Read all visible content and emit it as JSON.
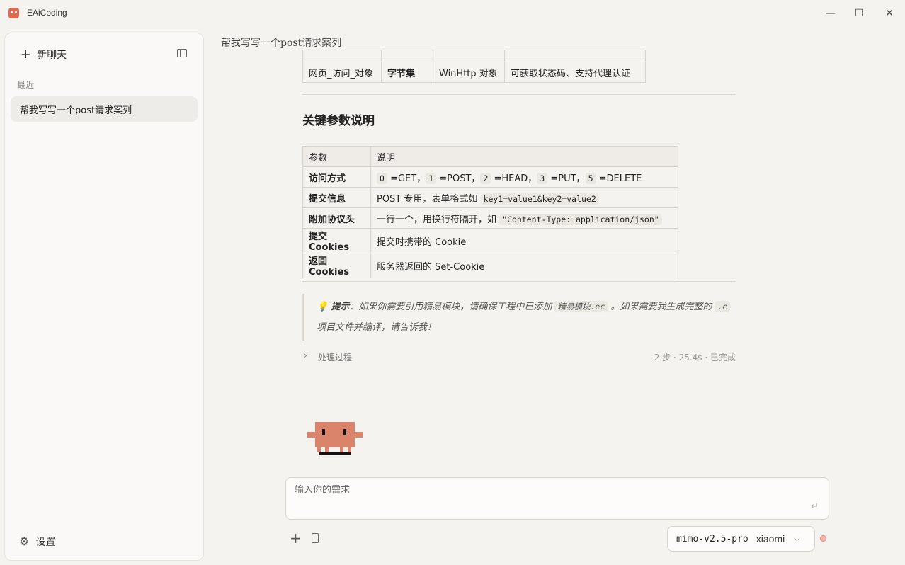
{
  "app": {
    "title": "EAiCoding"
  },
  "window_controls": {
    "minimize": "—",
    "maximize": "☐",
    "close": "✕"
  },
  "sidebar": {
    "new_chat_label": "新聊天",
    "section_recent": "最近",
    "history": [
      "帮我写写一个post请求案列"
    ],
    "settings_label": "设置"
  },
  "conversation": {
    "title": "帮我写写一个post请求案列",
    "table1": {
      "rows": [
        [
          "",
          "",
          "",
          ""
        ],
        [
          "网页_访问_对象",
          "字节集",
          "WinHttp 对象",
          "可获取状态码、支持代理认证"
        ]
      ]
    },
    "heading": "关键参数说明",
    "table2": {
      "headers": [
        "参数",
        "说明"
      ],
      "rows": [
        {
          "key": "访问方式",
          "parts": [
            [
              "0",
              "code"
            ],
            [
              " =GET，",
              "text"
            ],
            [
              "1",
              "code"
            ],
            [
              " =POST，",
              "text"
            ],
            [
              "2",
              "code"
            ],
            [
              " =HEAD，",
              "text"
            ],
            [
              "3",
              "code"
            ],
            [
              " =PUT，",
              "text"
            ],
            [
              "5",
              "code"
            ],
            [
              " =DELETE",
              "text"
            ]
          ]
        },
        {
          "key": "提交信息",
          "parts": [
            [
              "POST 专用，表单格式如 ",
              "text"
            ],
            [
              "key1=value1&key2=value2",
              "code"
            ]
          ]
        },
        {
          "key": "附加协议头",
          "parts": [
            [
              "一行一个，用换行符隔开，如 ",
              "text"
            ],
            [
              "\"Content-Type: application/json\"",
              "code"
            ]
          ]
        },
        {
          "key": "提交Cookies",
          "parts": [
            [
              "提交时携带的 Cookie",
              "text"
            ]
          ]
        },
        {
          "key": "返回Cookies",
          "parts": [
            [
              "服务器返回的 Set-Cookie",
              "text"
            ]
          ]
        }
      ]
    },
    "tip": {
      "emoji": "💡",
      "label": "提示",
      "text1": "：如果你需要引用精易模块，请确保工程中已添加 ",
      "code1": "精易模块.ec",
      "text2": " 。如果需要我生成完整的 ",
      "code2": ".e",
      "text3": " 项目文件并编译，请告诉我！"
    },
    "process": {
      "label": "处理过程",
      "status": "2 步 · 25.4s · 已完成"
    }
  },
  "composer": {
    "placeholder": "输入你的需求",
    "model_name": "mimo-v2.5-pro",
    "model_provider": "xiaomi"
  },
  "colors": {
    "accent": "#e06a4e",
    "mascot": "#d9846b"
  }
}
